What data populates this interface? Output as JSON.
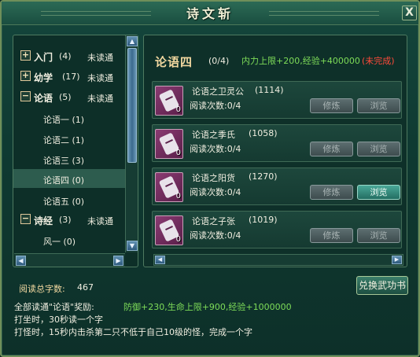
{
  "window": {
    "title": "诗文斩",
    "close_label": "X"
  },
  "tree": {
    "categories": [
      {
        "toggle": "+",
        "name": "入门",
        "count": "(4)",
        "status": "未读通"
      },
      {
        "toggle": "+",
        "name": "幼学",
        "count": "(17)",
        "status": "未读通"
      },
      {
        "toggle": "−",
        "name": "论语",
        "count": "(5)",
        "status": "未读通"
      }
    ],
    "sub_items": [
      {
        "name": "论语一",
        "count": "(1)"
      },
      {
        "name": "论语二",
        "count": "(1)"
      },
      {
        "name": "论语三",
        "count": "(3)"
      },
      {
        "name": "论语四",
        "count": "(0)",
        "selected": true
      },
      {
        "name": "论语五",
        "count": "(0)"
      }
    ],
    "category_poetry": {
      "toggle": "−",
      "name": "诗经",
      "count": "(3)",
      "status": "未读通"
    },
    "sub_poetry": {
      "name": "风一",
      "count": "(0)"
    },
    "scroll_up": "▲",
    "scroll_down": "▼",
    "scroll_left": "◀",
    "scroll_right": "▶"
  },
  "chapter": {
    "title": "论语四",
    "progress": "(0/4)",
    "reward": "内力上限+200,经验+400000",
    "status": "(未完成)"
  },
  "books": [
    {
      "name": "论语之卫灵公",
      "count": "(1114)",
      "read": "阅读次数:0/4",
      "qty": "0",
      "practice": "修炼",
      "browse": "浏览",
      "browse_enabled": false
    },
    {
      "name": "论语之季氏",
      "count": "(1058)",
      "read": "阅读次数:0/4",
      "qty": "0",
      "practice": "修炼",
      "browse": "浏览",
      "browse_enabled": false
    },
    {
      "name": "论语之阳货",
      "count": "(1270)",
      "read": "阅读次数:0/4",
      "qty": "0",
      "practice": "修炼",
      "browse": "浏览",
      "browse_enabled": true
    },
    {
      "name": "论语之子张",
      "count": "(1019)",
      "read": "阅读次数:0/4",
      "qty": "0",
      "practice": "修炼",
      "browse": "浏览",
      "browse_enabled": false
    }
  ],
  "footer": {
    "total_words_label": "阅读总字数:",
    "total_words_value": "467",
    "exchange_button": "兑换武功书",
    "reward_label": "全部读通\"论语\"奖励:",
    "reward_value": "防御+230,生命上限+900,经验+1000000",
    "rule1": "打坐时，30秒读一个字",
    "rule2": "打怪时，15秒内击杀第二只不低于自己10级的怪，完成一个字"
  },
  "colors": {
    "accent_green": "#7edc58",
    "warning_red": "#ff4a3a",
    "title_gold": "#f2d8a0"
  }
}
